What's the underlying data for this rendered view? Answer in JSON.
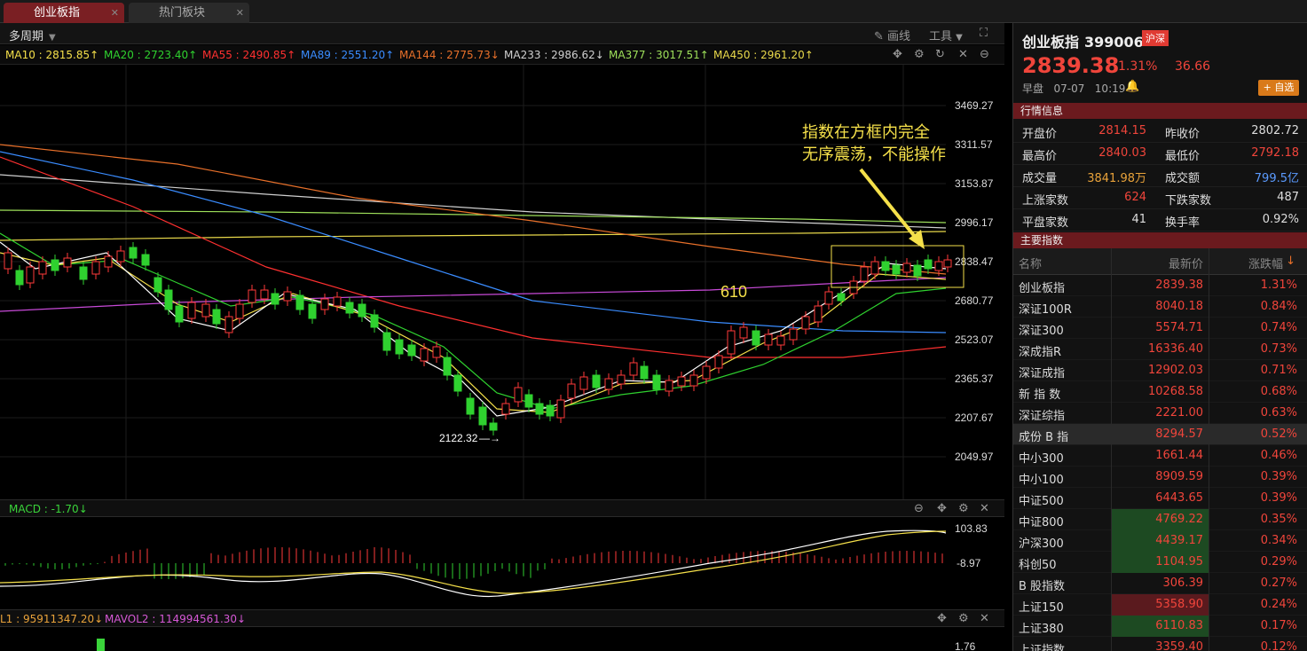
{
  "tabs": [
    {
      "label": "创业板指",
      "close": "✕"
    },
    {
      "label": "热门板块",
      "close": "✕"
    }
  ],
  "toolbar": {
    "period": "多周期",
    "draw": "画线",
    "tools": "工具"
  },
  "ma_lines": [
    {
      "label": "MA10 : 2815.85↑",
      "color": "#f5e04a"
    },
    {
      "label": "MA20 : 2723.40↑",
      "color": "#2fd12f"
    },
    {
      "label": "MA55 : 2490.85↑",
      "color": "#ff3030"
    },
    {
      "label": "MA89 : 2551.20↑",
      "color": "#3a8cff"
    },
    {
      "label": "MA144 : 2775.73↓",
      "color": "#e8702a"
    },
    {
      "label": "MA233 : 2986.62↓",
      "color": "#cfcfcf"
    },
    {
      "label": "MA377 : 3017.51↑",
      "color": "#9ee05a"
    },
    {
      "label": "MA450 : 2961.20↑",
      "color": "#e8d84a"
    }
  ],
  "price_axis": [
    "3469.27",
    "3311.57",
    "3153.87",
    "2996.17",
    "2838.47",
    "2680.77",
    "2523.07",
    "2365.37",
    "2207.67",
    "2049.97"
  ],
  "annotations": {
    "low_label": "2122.32",
    "count_label": "610",
    "note_line1": "指数在方框内完全",
    "note_line2": "无序震荡，不能操作"
  },
  "macd": {
    "label": "MACD : -1.70↓",
    "axis_top": "103.83",
    "axis_mid": "-8.97"
  },
  "vol": {
    "label1": "L1 : 95911347.20↓",
    "label2": "MAVOL2 : 114994561.30↓",
    "axis_top": "1.76"
  },
  "stock": {
    "name": "创业板指",
    "code": "399006",
    "market": "沪深",
    "price": "2839.38",
    "pct": "1.31%",
    "change": "36.66",
    "session": "早盘",
    "date": "07-07",
    "time": "10:19",
    "watch": "+ 自选"
  },
  "quote_section": "行情信息",
  "quotes": [
    {
      "l1": "开盘价",
      "v1": "2814.15",
      "c1": "#f0453b",
      "l2": "昨收价",
      "v2": "2802.72",
      "c2": "#ddd"
    },
    {
      "l1": "最高价",
      "v1": "2840.03",
      "c1": "#f0453b",
      "l2": "最低价",
      "v2": "2792.18",
      "c2": "#f0453b"
    },
    {
      "l1": "成交量",
      "v1": "3841.98万",
      "c1": "#e8a23a",
      "l2": "成交额",
      "v2": "799.5亿",
      "c2": "#5b9bff"
    },
    {
      "l1": "上涨家数",
      "v1": "624",
      "c1": "#f0453b",
      "l2": "下跌家数",
      "v2": "487",
      "c2": "#ddd"
    },
    {
      "l1": "平盘家数",
      "v1": "41",
      "c1": "#ddd",
      "l2": "换手率",
      "v2": "0.92%",
      "c2": "#ddd"
    }
  ],
  "index_section": "主要指数",
  "index_header": {
    "name": "名称",
    "price": "最新价",
    "pct": "涨跌幅"
  },
  "indices": [
    {
      "name": "创业板指",
      "price": "2839.38",
      "pct": "1.31%"
    },
    {
      "name": "深证100R",
      "price": "8040.18",
      "pct": "0.84%"
    },
    {
      "name": "深证300",
      "price": "5574.71",
      "pct": "0.74%"
    },
    {
      "name": "深成指R",
      "price": "16336.40",
      "pct": "0.73%"
    },
    {
      "name": "深证成指",
      "price": "12902.03",
      "pct": "0.71%"
    },
    {
      "name": "新 指 数",
      "price": "10268.58",
      "pct": "0.68%"
    },
    {
      "name": "深证综指",
      "price": "2221.00",
      "pct": "0.63%"
    },
    {
      "name": "成份 B 指",
      "price": "8294.57",
      "pct": "0.52%"
    },
    {
      "name": "中小300",
      "price": "1661.44",
      "pct": "0.46%"
    },
    {
      "name": "中小100",
      "price": "8909.59",
      "pct": "0.39%"
    },
    {
      "name": "中证500",
      "price": "6443.65",
      "pct": "0.39%"
    },
    {
      "name": "中证800",
      "price": "4769.22",
      "pct": "0.35%"
    },
    {
      "name": "沪深300",
      "price": "4439.17",
      "pct": "0.34%"
    },
    {
      "name": "科创50",
      "price": "1104.95",
      "pct": "0.29%"
    },
    {
      "name": "B 股指数",
      "price": "306.39",
      "pct": "0.27%"
    },
    {
      "name": "上证150",
      "price": "5358.90",
      "pct": "0.24%"
    },
    {
      "name": "上证380",
      "price": "6110.83",
      "pct": "0.17%"
    },
    {
      "name": "上证指数",
      "price": "3359.40",
      "pct": "0.12%"
    }
  ]
}
